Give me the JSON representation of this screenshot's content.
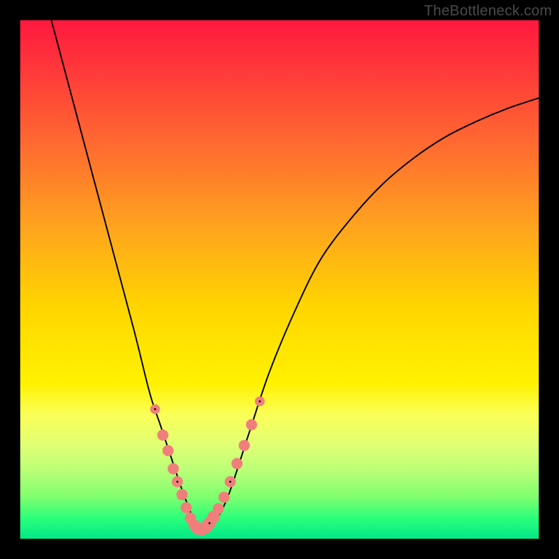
{
  "watermark": "TheBottleneck.com",
  "chart_data": {
    "type": "line",
    "title": "",
    "xlabel": "",
    "ylabel": "",
    "xlim": [
      0,
      100
    ],
    "ylim": [
      0,
      100
    ],
    "legend": false,
    "grid": false,
    "series": [
      {
        "name": "curve",
        "color": "#000000",
        "x": [
          6,
          10,
          14,
          18,
          22,
          25,
          27,
          29,
          31,
          32.5,
          33.5,
          34.5,
          35.5,
          37,
          40,
          44,
          48,
          53,
          58,
          64,
          70,
          76,
          82,
          88,
          94,
          100
        ],
        "y": [
          100,
          85,
          70,
          55,
          40,
          28,
          22,
          16,
          10,
          6,
          3.5,
          2,
          1.5,
          2.5,
          8,
          20,
          32,
          44,
          54,
          62,
          68.5,
          73.5,
          77.5,
          80.5,
          83,
          85
        ]
      }
    ],
    "highlight_points": {
      "name": "highlighted-nodes",
      "color": "#f07f7c",
      "points": [
        {
          "x": 26.0,
          "y": 25.0
        },
        {
          "x": 27.5,
          "y": 20.0
        },
        {
          "x": 28.5,
          "y": 17.0
        },
        {
          "x": 29.5,
          "y": 13.5
        },
        {
          "x": 30.3,
          "y": 11.0
        },
        {
          "x": 31.2,
          "y": 8.5
        },
        {
          "x": 32.0,
          "y": 6.0
        },
        {
          "x": 32.8,
          "y": 4.0
        },
        {
          "x": 33.5,
          "y": 2.7
        },
        {
          "x": 34.2,
          "y": 2.0
        },
        {
          "x": 35.0,
          "y": 1.8
        },
        {
          "x": 35.8,
          "y": 2.2
        },
        {
          "x": 36.5,
          "y": 3.0
        },
        {
          "x": 37.3,
          "y": 4.2
        },
        {
          "x": 38.2,
          "y": 5.8
        },
        {
          "x": 39.3,
          "y": 8.0
        },
        {
          "x": 40.5,
          "y": 11.0
        },
        {
          "x": 41.8,
          "y": 14.5
        },
        {
          "x": 43.2,
          "y": 18.0
        },
        {
          "x": 44.6,
          "y": 22.0
        },
        {
          "x": 46.2,
          "y": 26.5
        }
      ]
    }
  }
}
